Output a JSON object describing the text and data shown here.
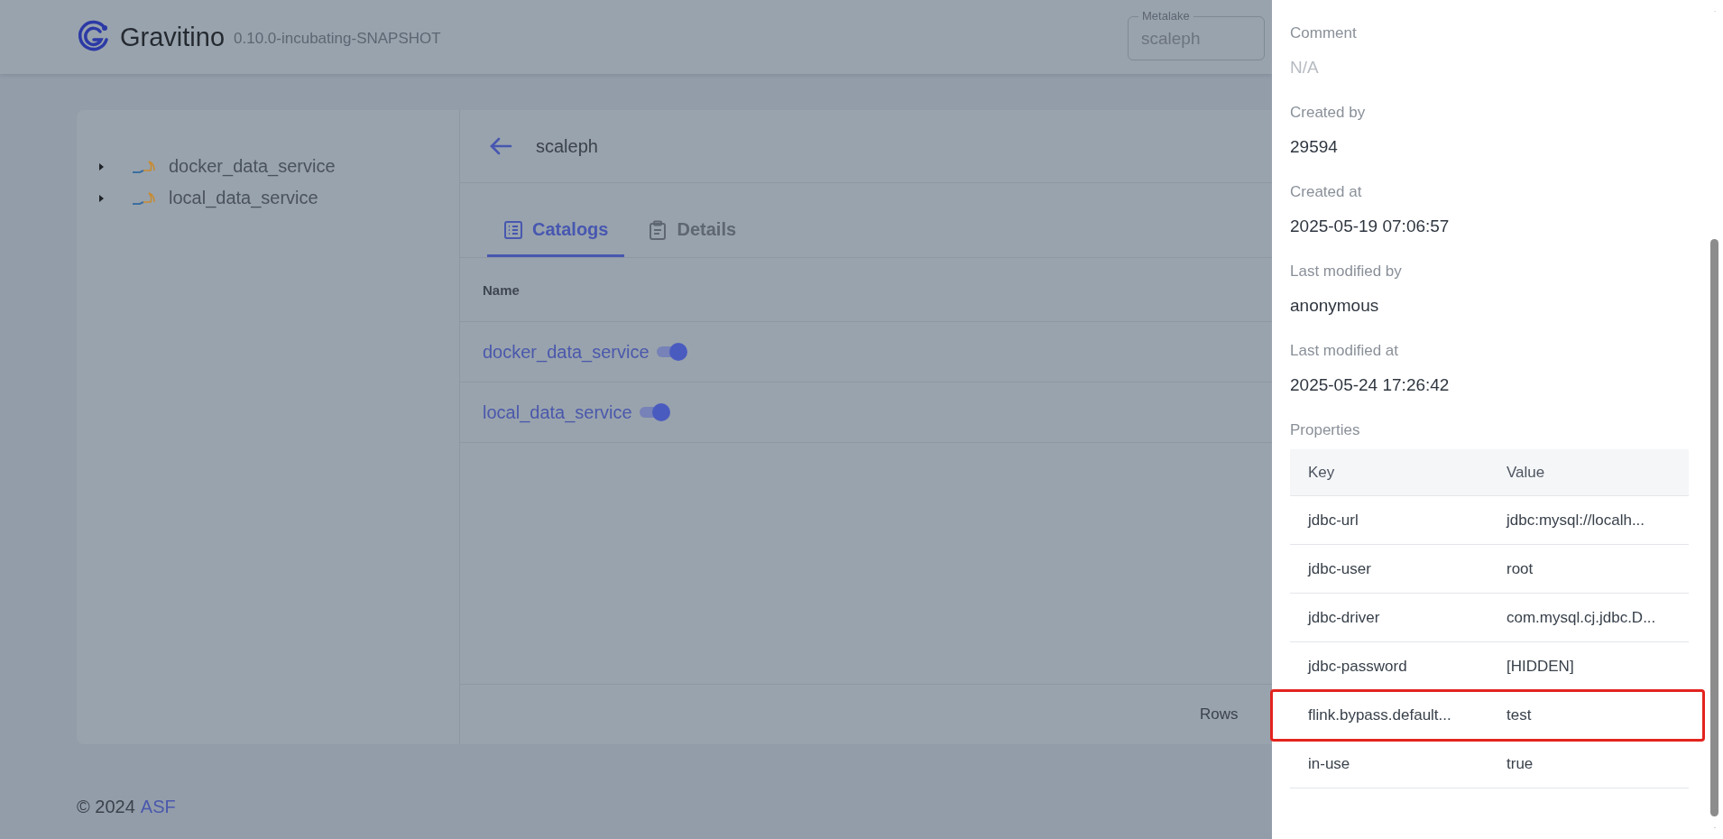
{
  "header": {
    "brand": "Gravitino",
    "version": "0.10.0-incubating-SNAPSHOT",
    "metalake_select": {
      "label": "Metalake",
      "value": "scaleph"
    }
  },
  "tree": {
    "items": [
      {
        "label": "docker_data_service",
        "expanded": false
      },
      {
        "label": "local_data_service",
        "expanded": false
      }
    ]
  },
  "detail": {
    "title": "scaleph",
    "tabs": [
      {
        "label": "Catalogs",
        "selected": true
      },
      {
        "label": "Details",
        "selected": false
      }
    ],
    "table": {
      "columns": [
        "Name"
      ],
      "rows": [
        {
          "name": "docker_data_service",
          "in_use": true
        },
        {
          "name": "local_data_service",
          "in_use": true
        }
      ]
    },
    "pagination_label": "Rows"
  },
  "footer": {
    "copyright": "© 2024",
    "link": "ASF"
  },
  "drawer": {
    "fields": [
      {
        "label": "Comment",
        "value": "N/A",
        "empty": true
      },
      {
        "label": "Created by",
        "value": "29594",
        "empty": false
      },
      {
        "label": "Created at",
        "value": "2025-05-19 07:06:57",
        "empty": false
      },
      {
        "label": "Last modified by",
        "value": "anonymous",
        "empty": false
      },
      {
        "label": "Last modified at",
        "value": "2025-05-24 17:26:42",
        "empty": false
      }
    ],
    "properties": {
      "label": "Properties",
      "columns": [
        "Key",
        "Value"
      ],
      "rows": [
        {
          "key": "jdbc-url",
          "value": "jdbc:mysql://localh...",
          "highlighted": false
        },
        {
          "key": "jdbc-user",
          "value": "root",
          "highlighted": false
        },
        {
          "key": "jdbc-driver",
          "value": "com.mysql.cj.jdbc.D...",
          "highlighted": false
        },
        {
          "key": "jdbc-password",
          "value": "[HIDDEN]",
          "highlighted": false
        },
        {
          "key": "flink.bypass.default...",
          "value": "test",
          "highlighted": true
        },
        {
          "key": "in-use",
          "value": "true",
          "highlighted": false
        }
      ]
    }
  }
}
